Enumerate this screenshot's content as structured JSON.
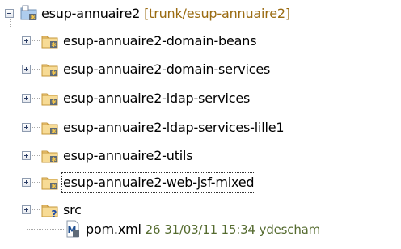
{
  "tree": {
    "root": {
      "label": "esup-annuaire2",
      "branch": "[trunk/esup-annuaire2]",
      "expanded": true,
      "icon": "project-folder-icon"
    },
    "children": [
      {
        "label": "esup-annuaire2-domain-beans",
        "icon": "package-folder-icon"
      },
      {
        "label": "esup-annuaire2-domain-services",
        "icon": "package-folder-icon"
      },
      {
        "label": "esup-annuaire2-ldap-services",
        "icon": "package-folder-icon"
      },
      {
        "label": "esup-annuaire2-ldap-services-lille1",
        "icon": "package-folder-icon"
      },
      {
        "label": "esup-annuaire2-utils",
        "icon": "package-folder-icon"
      },
      {
        "label": "esup-annuaire2-web-jsf-mixed",
        "icon": "package-folder-icon",
        "focused": true
      },
      {
        "label": "src",
        "icon": "unversioned-folder-icon"
      }
    ],
    "file": {
      "label": "pom.xml",
      "revision": "26",
      "date": "31/03/11 15:34",
      "author": "ydescham",
      "icon": "maven-file-icon"
    }
  }
}
